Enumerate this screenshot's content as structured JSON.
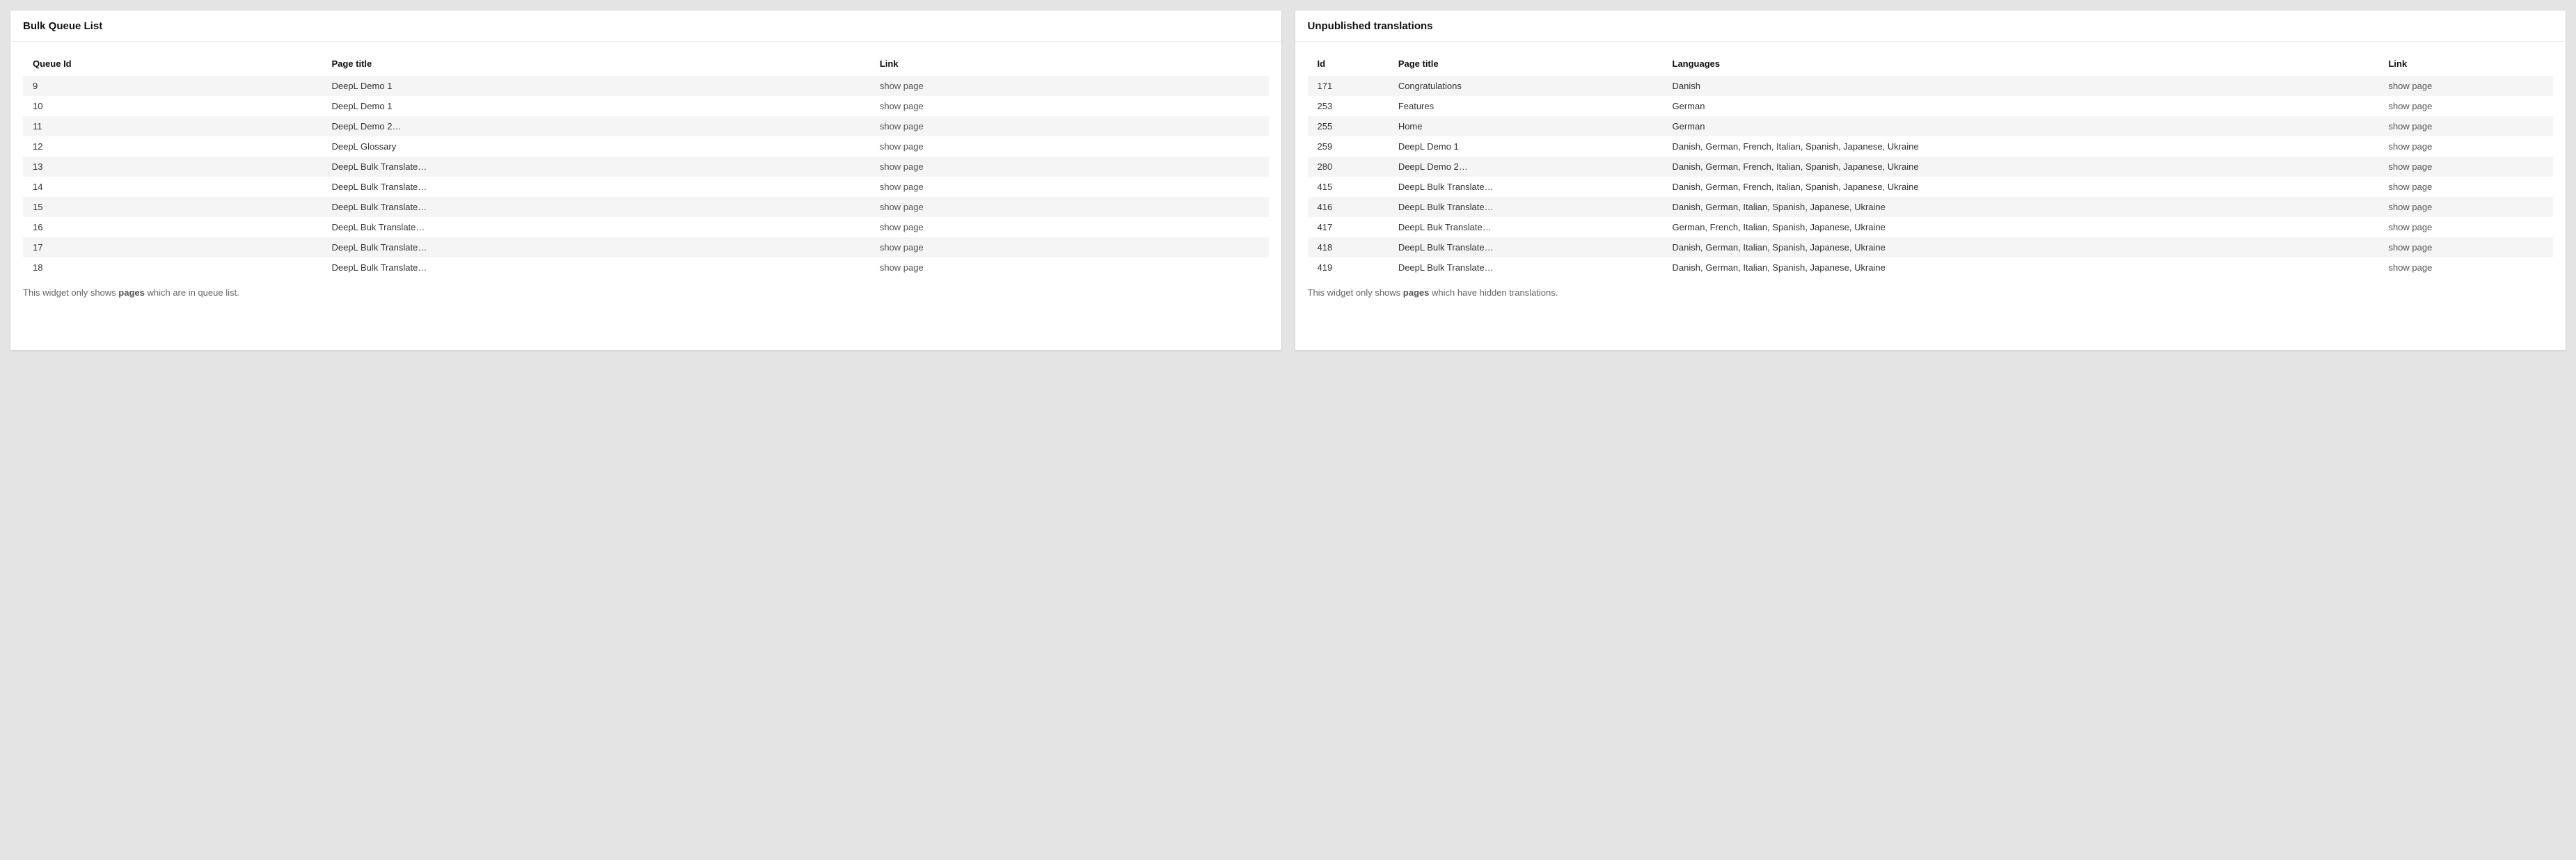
{
  "queue_widget": {
    "title": "Bulk Queue List",
    "columns": {
      "id": "Queue Id",
      "title": "Page title",
      "link": "Link"
    },
    "link_label": "show page",
    "rows": [
      {
        "id": "9",
        "title": "DeepL Demo 1"
      },
      {
        "id": "10",
        "title": "DeepL Demo 1"
      },
      {
        "id": "11",
        "title": "DeepL Demo 2…"
      },
      {
        "id": "12",
        "title": "DeepL Glossary"
      },
      {
        "id": "13",
        "title": "DeepL Bulk Translate…"
      },
      {
        "id": "14",
        "title": "DeepL Bulk Translate…"
      },
      {
        "id": "15",
        "title": "DeepL Bulk Translate…"
      },
      {
        "id": "16",
        "title": "DeepL Buk Translate…"
      },
      {
        "id": "17",
        "title": "DeepL Bulk Translate…"
      },
      {
        "id": "18",
        "title": "DeepL Bulk Translate…"
      }
    ],
    "footer": {
      "pre": "This widget only shows ",
      "bold": "pages",
      "post": " which are in queue list."
    }
  },
  "unpub_widget": {
    "title": "Unpublished translations",
    "columns": {
      "id": "Id",
      "title": "Page title",
      "langs": "Languages",
      "link": "Link"
    },
    "link_label": "show page",
    "rows": [
      {
        "id": "171",
        "title": "Congratulations",
        "langs": "Danish"
      },
      {
        "id": "253",
        "title": "Features",
        "langs": "German"
      },
      {
        "id": "255",
        "title": "Home",
        "langs": "German"
      },
      {
        "id": "259",
        "title": "DeepL Demo 1",
        "langs": "Danish, German, French, Italian, Spanish, Japanese, Ukraine"
      },
      {
        "id": "280",
        "title": "DeepL Demo 2…",
        "langs": "Danish, German, French, Italian, Spanish, Japanese, Ukraine"
      },
      {
        "id": "415",
        "title": "DeepL Bulk Translate…",
        "langs": "Danish, German, French, Italian, Spanish, Japanese, Ukraine"
      },
      {
        "id": "416",
        "title": "DeepL Bulk Translate…",
        "langs": "Danish, German, Italian, Spanish, Japanese, Ukraine"
      },
      {
        "id": "417",
        "title": "DeepL Buk Translate…",
        "langs": "German, French, Italian, Spanish, Japanese, Ukraine"
      },
      {
        "id": "418",
        "title": "DeepL Bulk Translate…",
        "langs": "Danish, German, Italian, Spanish, Japanese, Ukraine"
      },
      {
        "id": "419",
        "title": "DeepL Bulk Translate…",
        "langs": "Danish, German, Italian, Spanish, Japanese, Ukraine"
      }
    ],
    "footer": {
      "pre": "This widget only shows ",
      "bold": "pages",
      "post": " which have hidden translations."
    }
  }
}
